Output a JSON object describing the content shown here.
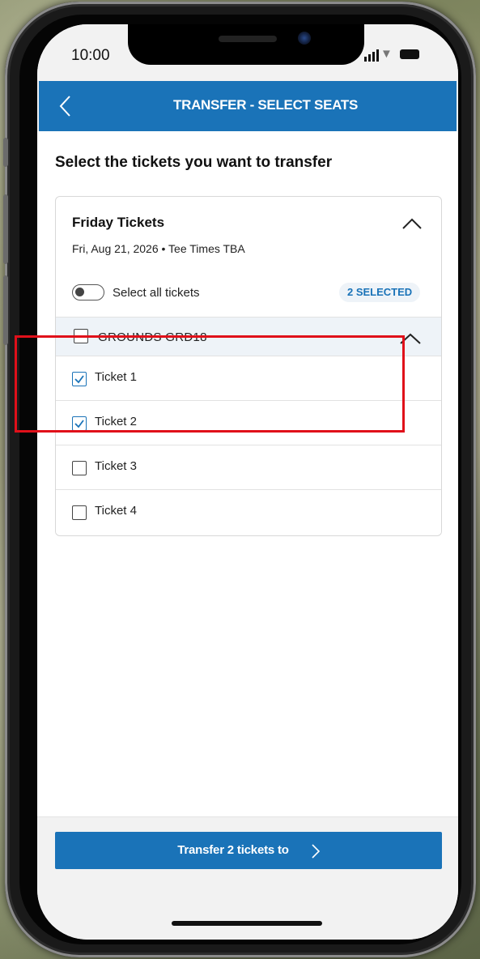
{
  "status_bar": {
    "time": "10:00"
  },
  "header": {
    "title": "TRANSFER - SELECT SEATS"
  },
  "page": {
    "heading": "Select the tickets you want to transfer"
  },
  "card": {
    "title": "Friday Tickets",
    "date": "Fri, Aug 21, 2026 • Tee Times TBA",
    "select_all_label": "Select all tickets",
    "select_all_on": false,
    "selected_badge": "2 SELECTED",
    "section": {
      "label": "GROUNDS GRD18",
      "checked": false
    },
    "tickets": [
      {
        "label": "Ticket 1",
        "checked": true
      },
      {
        "label": "Ticket 2",
        "checked": true
      },
      {
        "label": "Ticket 3",
        "checked": false
      },
      {
        "label": "Ticket 4",
        "checked": false
      }
    ]
  },
  "footer": {
    "cta_label": "Transfer 2 tickets to"
  },
  "icons": {
    "back": "chevron-left-icon",
    "collapse": "chevron-up-icon",
    "cta_arrow": "chevron-right-icon",
    "check": "check-icon"
  },
  "colors": {
    "brand_blue": "#1a73b8",
    "highlight_red": "#e0101a",
    "section_bg": "#eef3f8"
  }
}
